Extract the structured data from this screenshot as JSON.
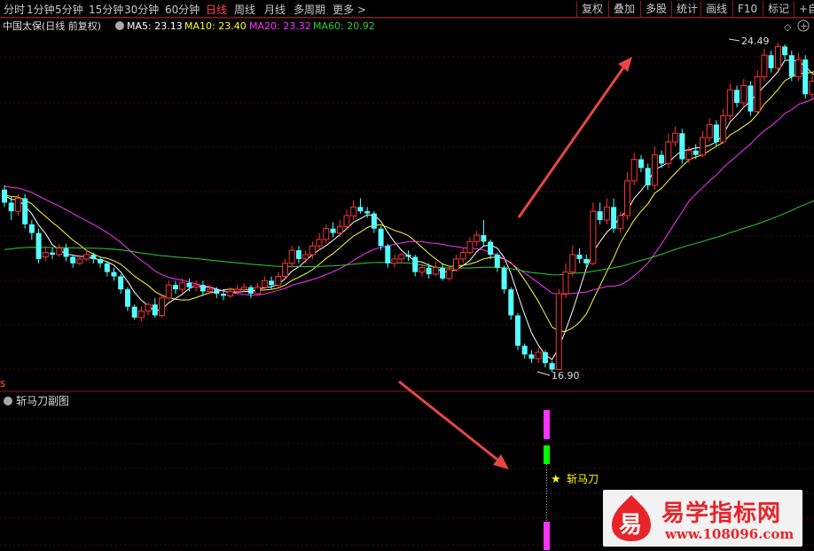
{
  "toolbar": {
    "periods": [
      "分时",
      "1分钟",
      "5分钟",
      "15分钟",
      "30分钟",
      "60分钟",
      "日线",
      "周线",
      "月线",
      "多周期",
      "更多 >"
    ],
    "active": "日线",
    "right_buttons": [
      "复权",
      "叠加",
      "多股",
      "统计",
      "画线",
      "F10",
      "标记",
      "+自"
    ]
  },
  "main_title": {
    "stock": "中国太保(日线 前复权)",
    "ma5": "MA5: 23.13",
    "ma10": "MA10: 23.40",
    "ma20": "MA20: 23.32",
    "ma60": "MA60: 20.92"
  },
  "colors": {
    "up": "#ff3232",
    "down": "#54ffff",
    "ma5": "#ffffff",
    "ma10": "#ffff33",
    "ma20": "#ff33ff",
    "ma60": "#33cc33",
    "grid": "#8b1a1a",
    "signal_magenta": "#ff33ff",
    "signal_green": "#00ff00",
    "signal_star": "#ffff00"
  },
  "annotations": {
    "high_label": "24.49",
    "low_label": "16.90"
  },
  "sub_chart": {
    "title": "斩马刀副图",
    "signal_label": "斩马刀",
    "corner_label": "s"
  },
  "watermark": {
    "logo_char": "易",
    "title": "易学指标网",
    "url": "www.108096.com"
  },
  "chart_data": {
    "type": "candlestick",
    "price_range": [
      16.9,
      24.49
    ],
    "high": 24.49,
    "low": 16.9,
    "series_names": [
      "MA5",
      "MA10",
      "MA20",
      "MA60"
    ],
    "last_values": {
      "MA5": 23.13,
      "MA10": 23.4,
      "MA20": 23.32,
      "MA60": 20.92
    },
    "candles": [
      [
        21.1,
        20.8,
        21.2,
        20.7
      ],
      [
        20.8,
        20.6,
        20.95,
        20.4
      ],
      [
        20.6,
        20.9,
        21.0,
        20.5
      ],
      [
        20.9,
        20.3,
        21.0,
        20.2
      ],
      [
        20.3,
        20.1,
        20.4,
        19.95
      ],
      [
        20.1,
        19.5,
        20.2,
        19.4
      ],
      [
        19.55,
        19.65,
        19.8,
        19.45
      ],
      [
        19.65,
        19.6,
        19.75,
        19.5
      ],
      [
        19.6,
        19.75,
        19.85,
        19.55
      ],
      [
        19.75,
        19.55,
        19.85,
        19.45
      ],
      [
        19.55,
        19.4,
        19.6,
        19.3
      ],
      [
        19.4,
        19.5,
        19.6,
        19.35
      ],
      [
        19.5,
        19.6,
        19.7,
        19.45
      ],
      [
        19.6,
        19.5,
        19.65,
        19.4
      ],
      [
        19.5,
        19.4,
        19.55,
        19.3
      ],
      [
        19.4,
        19.2,
        19.45,
        19.1
      ],
      [
        19.2,
        19.1,
        19.3,
        19.0
      ],
      [
        19.1,
        18.8,
        19.15,
        18.7
      ],
      [
        18.8,
        18.4,
        18.85,
        18.3
      ],
      [
        18.4,
        18.15,
        18.45,
        18.1
      ],
      [
        18.15,
        18.3,
        18.4,
        18.05
      ],
      [
        18.3,
        18.45,
        18.5,
        18.2
      ],
      [
        18.45,
        18.2,
        18.6,
        18.15
      ],
      [
        18.2,
        18.6,
        18.7,
        18.15
      ],
      [
        18.6,
        18.9,
        19.0,
        18.55
      ],
      [
        18.9,
        18.8,
        19.0,
        18.7
      ],
      [
        18.8,
        18.95,
        19.05,
        18.7
      ],
      [
        18.95,
        18.85,
        19.05,
        18.75
      ],
      [
        18.85,
        18.9,
        19.0,
        18.75
      ],
      [
        18.9,
        18.75,
        19.0,
        18.65
      ],
      [
        18.75,
        18.8,
        18.9,
        18.7
      ],
      [
        18.8,
        18.7,
        18.85,
        18.6
      ],
      [
        18.7,
        18.65,
        18.8,
        18.55
      ],
      [
        18.65,
        18.75,
        18.85,
        18.6
      ],
      [
        18.75,
        18.8,
        18.9,
        18.7
      ],
      [
        18.8,
        18.85,
        18.95,
        18.75
      ],
      [
        18.85,
        18.7,
        18.9,
        18.6
      ],
      [
        18.7,
        18.85,
        18.95,
        18.65
      ],
      [
        18.85,
        19.0,
        19.1,
        18.8
      ],
      [
        19.0,
        18.9,
        19.1,
        18.8
      ],
      [
        18.9,
        19.1,
        19.2,
        18.85
      ],
      [
        19.1,
        19.4,
        19.5,
        19.05
      ],
      [
        19.4,
        19.7,
        19.8,
        19.3
      ],
      [
        19.7,
        19.5,
        19.8,
        19.4
      ],
      [
        19.5,
        19.6,
        19.7,
        19.4
      ],
      [
        19.6,
        19.8,
        19.9,
        19.5
      ],
      [
        19.8,
        19.95,
        20.1,
        19.7
      ],
      [
        19.95,
        20.2,
        20.3,
        19.85
      ],
      [
        20.2,
        20.1,
        20.35,
        20.0
      ],
      [
        20.1,
        20.25,
        20.4,
        20.0
      ],
      [
        20.25,
        20.5,
        20.65,
        20.2
      ],
      [
        20.5,
        20.7,
        20.85,
        20.4
      ],
      [
        20.7,
        20.6,
        20.9,
        20.55
      ],
      [
        20.6,
        20.55,
        20.7,
        20.45
      ],
      [
        20.55,
        20.2,
        20.6,
        20.1
      ],
      [
        20.2,
        19.8,
        20.25,
        19.7
      ],
      [
        19.8,
        19.4,
        19.85,
        19.3
      ],
      [
        19.4,
        19.5,
        19.6,
        19.3
      ],
      [
        19.5,
        19.6,
        19.65,
        19.4
      ],
      [
        19.6,
        19.55,
        19.7,
        19.45
      ],
      [
        19.55,
        19.2,
        19.6,
        19.1
      ],
      [
        19.2,
        19.3,
        19.4,
        19.1
      ],
      [
        19.3,
        19.15,
        19.4,
        19.05
      ],
      [
        19.15,
        19.3,
        19.45,
        19.1
      ],
      [
        19.3,
        19.05,
        19.4,
        19.0
      ],
      [
        19.05,
        19.25,
        19.35,
        19.0
      ],
      [
        19.25,
        19.5,
        19.6,
        19.2
      ],
      [
        19.5,
        19.65,
        19.75,
        19.4
      ],
      [
        19.65,
        19.9,
        20.0,
        19.6
      ],
      [
        19.9,
        20.05,
        20.15,
        19.8
      ],
      [
        20.05,
        19.9,
        20.4,
        19.8
      ],
      [
        19.9,
        19.6,
        19.95,
        19.5
      ],
      [
        19.6,
        19.3,
        19.65,
        19.2
      ],
      [
        19.3,
        18.8,
        19.35,
        18.7
      ],
      [
        18.8,
        18.2,
        18.85,
        18.1
      ],
      [
        18.2,
        17.5,
        18.25,
        17.4
      ],
      [
        17.5,
        17.3,
        17.55,
        17.2
      ],
      [
        17.3,
        17.2,
        17.4,
        17.1
      ],
      [
        17.2,
        17.35,
        17.45,
        17.1
      ],
      [
        17.35,
        17.1,
        17.4,
        17.0
      ],
      [
        17.1,
        16.95,
        17.15,
        16.9
      ],
      [
        16.95,
        18.7,
        18.8,
        16.95
      ],
      [
        18.7,
        19.2,
        19.4,
        18.6
      ],
      [
        19.2,
        19.6,
        19.8,
        19.1
      ],
      [
        19.6,
        19.5,
        19.75,
        19.4
      ],
      [
        19.5,
        19.4,
        19.6,
        19.3
      ],
      [
        19.4,
        20.6,
        20.8,
        19.35
      ],
      [
        20.6,
        20.4,
        20.8,
        20.3
      ],
      [
        20.4,
        20.7,
        20.9,
        20.3
      ],
      [
        20.7,
        20.2,
        20.9,
        20.1
      ],
      [
        20.2,
        20.5,
        20.6,
        20.1
      ],
      [
        20.5,
        21.3,
        21.5,
        20.4
      ],
      [
        21.3,
        21.8,
        21.95,
        21.2
      ],
      [
        21.8,
        21.6,
        21.9,
        21.5
      ],
      [
        21.6,
        21.2,
        21.7,
        21.1
      ],
      [
        21.2,
        21.9,
        22.1,
        21.1
      ],
      [
        21.9,
        21.7,
        22.0,
        21.6
      ],
      [
        21.7,
        22.2,
        22.4,
        21.6
      ],
      [
        22.2,
        22.4,
        22.55,
        22.1
      ],
      [
        22.4,
        21.8,
        22.5,
        21.7
      ],
      [
        21.8,
        22.0,
        22.1,
        21.7
      ],
      [
        22.0,
        21.9,
        22.15,
        21.8
      ],
      [
        21.9,
        22.3,
        22.45,
        21.85
      ],
      [
        22.3,
        22.6,
        22.75,
        22.2
      ],
      [
        22.6,
        22.2,
        22.7,
        22.1
      ],
      [
        22.2,
        22.8,
        22.95,
        22.15
      ],
      [
        22.8,
        23.4,
        23.55,
        22.7
      ],
      [
        23.4,
        23.1,
        23.5,
        23.0
      ],
      [
        23.1,
        23.5,
        23.65,
        23.0
      ],
      [
        23.5,
        22.9,
        23.6,
        22.8
      ],
      [
        22.9,
        23.7,
        23.85,
        22.85
      ],
      [
        23.7,
        24.2,
        24.35,
        23.6
      ],
      [
        24.2,
        23.9,
        24.3,
        23.8
      ],
      [
        23.9,
        24.4,
        24.49,
        23.85
      ],
      [
        24.4,
        24.2,
        24.45,
        24.1
      ],
      [
        24.2,
        23.7,
        24.3,
        23.6
      ],
      [
        23.7,
        24.1,
        24.25,
        23.6
      ],
      [
        24.1,
        23.3,
        24.2,
        23.2
      ],
      [
        23.3,
        23.6,
        23.75,
        23.2
      ],
      [
        23.6,
        23.8,
        23.95,
        23.5
      ],
      [
        23.8,
        23.4,
        23.9,
        23.3
      ],
      [
        23.4,
        23.7,
        23.85,
        23.3
      ],
      [
        23.7,
        23.2,
        23.75,
        23.1
      ],
      [
        23.2,
        23.3,
        23.4,
        22.9
      ],
      [
        23.3,
        23.13,
        23.4,
        23.0
      ]
    ]
  }
}
